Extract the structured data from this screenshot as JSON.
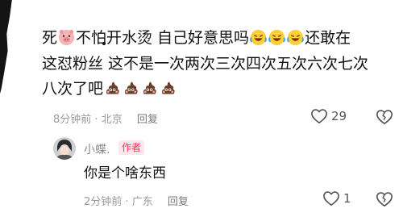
{
  "comment": {
    "lines": [
      [
        "死",
        "不怕开水烫 自己好意思吗",
        "还敢在"
      ],
      [
        "这怼粉丝 这不是一次两次三次四次五次六次七次"
      ],
      [
        "八次了吧"
      ]
    ],
    "emoji": {
      "pig": "pig-face-emoji",
      "laugh_cry": "laughing-crying-emoji",
      "poop": "poop-emoji"
    },
    "time": "8分钟前",
    "location": "北京",
    "reply_label": "回复",
    "likes": "29"
  },
  "reply": {
    "username": "小蝶.",
    "badge": "作者",
    "text": "你是个啥东西",
    "time": "2分钟前",
    "location": "广东",
    "reply_label": "回复",
    "likes": "1"
  },
  "colors": {
    "badge_text": "#fe2c55",
    "badge_bg": "#fde7ec",
    "meta_gray": "#9a9a9a"
  }
}
